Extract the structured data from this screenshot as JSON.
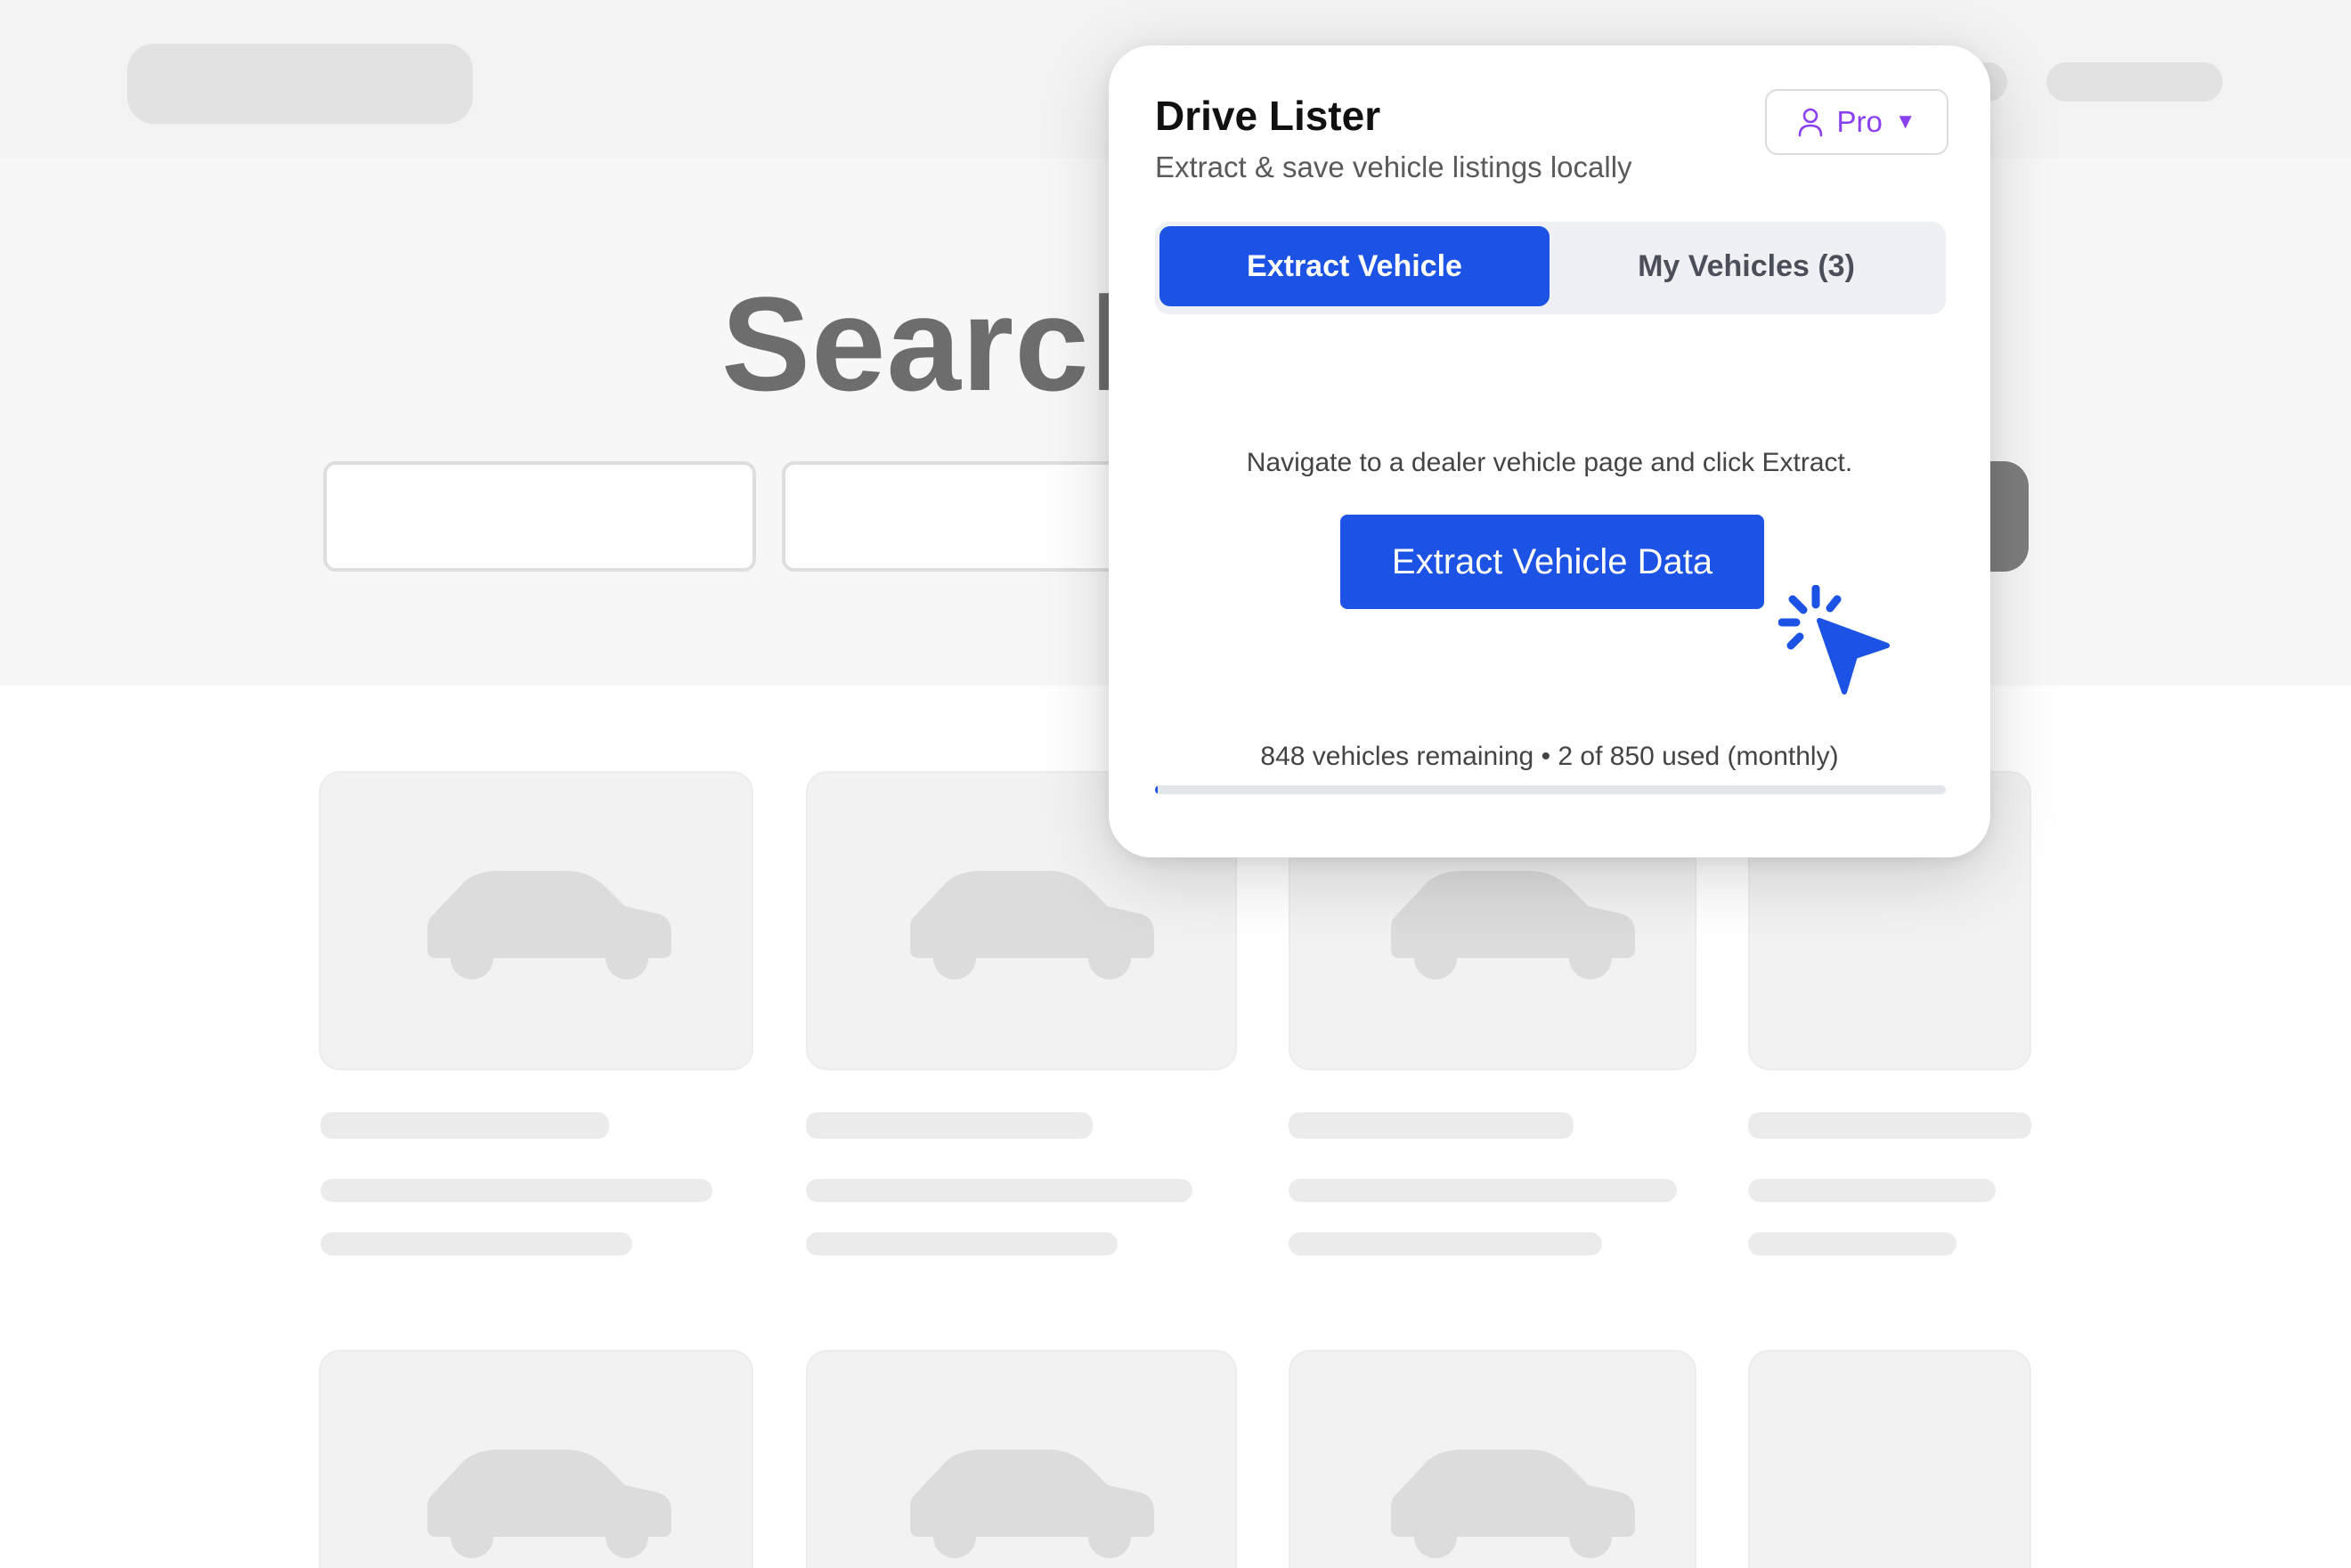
{
  "background_page": {
    "hero_title": "Search"
  },
  "popup": {
    "title": "Drive Lister",
    "subtitle": "Extract & save vehicle listings locally",
    "plan_button": {
      "icon": "user-icon",
      "label": "Pro",
      "caret": "▼"
    },
    "tabs": [
      {
        "label": "Extract Vehicle",
        "active": true
      },
      {
        "label": "My Vehicles (3)",
        "active": false
      }
    ],
    "hint": "Navigate to a dealer vehicle page and click Extract.",
    "extract_button": "Extract Vehicle Data",
    "usage": {
      "text": "848 vehicles remaining • 2 of 850 used (monthly)",
      "used": 2,
      "limit": 850,
      "remaining": 848
    }
  },
  "colors": {
    "accent": "#1c53e4",
    "plan": "#8a3ff0"
  }
}
